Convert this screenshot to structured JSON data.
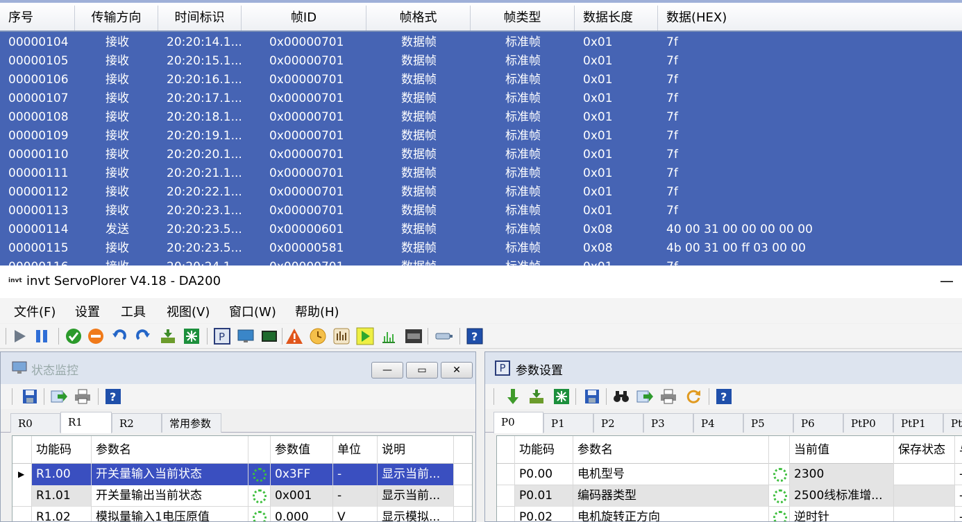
{
  "can_grid": {
    "columns": [
      "序号",
      "传输方向",
      "时间标识",
      "帧ID",
      "帧格式",
      "帧类型",
      "数据长度",
      "数据(HEX)"
    ],
    "rows": [
      [
        "00000104",
        "接收",
        "20:20:14.1...",
        "0x00000701",
        "数据帧",
        "标准帧",
        "0x01",
        "7f"
      ],
      [
        "00000105",
        "接收",
        "20:20:15.1...",
        "0x00000701",
        "数据帧",
        "标准帧",
        "0x01",
        "7f"
      ],
      [
        "00000106",
        "接收",
        "20:20:16.1...",
        "0x00000701",
        "数据帧",
        "标准帧",
        "0x01",
        "7f"
      ],
      [
        "00000107",
        "接收",
        "20:20:17.1...",
        "0x00000701",
        "数据帧",
        "标准帧",
        "0x01",
        "7f"
      ],
      [
        "00000108",
        "接收",
        "20:20:18.1...",
        "0x00000701",
        "数据帧",
        "标准帧",
        "0x01",
        "7f"
      ],
      [
        "00000109",
        "接收",
        "20:20:19.1...",
        "0x00000701",
        "数据帧",
        "标准帧",
        "0x01",
        "7f"
      ],
      [
        "00000110",
        "接收",
        "20:20:20.1...",
        "0x00000701",
        "数据帧",
        "标准帧",
        "0x01",
        "7f"
      ],
      [
        "00000111",
        "接收",
        "20:20:21.1...",
        "0x00000701",
        "数据帧",
        "标准帧",
        "0x01",
        "7f"
      ],
      [
        "00000112",
        "接收",
        "20:20:22.1...",
        "0x00000701",
        "数据帧",
        "标准帧",
        "0x01",
        "7f"
      ],
      [
        "00000113",
        "接收",
        "20:20:23.1...",
        "0x00000701",
        "数据帧",
        "标准帧",
        "0x01",
        "7f"
      ],
      [
        "00000114",
        "发送",
        "20:20:23.5...",
        "0x00000601",
        "数据帧",
        "标准帧",
        "0x08",
        "40 00 31 00 00 00 00 00"
      ],
      [
        "00000115",
        "接收",
        "20:20:23.5...",
        "0x00000581",
        "数据帧",
        "标准帧",
        "0x08",
        "4b 00 31 00 ff 03 00 00"
      ]
    ],
    "partial_row": [
      "00000116",
      "接收",
      "20:20:24.1...",
      "0x00000701",
      "数据帧",
      "标准帧",
      "0x01",
      "7f"
    ],
    "selection_color": "#4664b4"
  },
  "window": {
    "logo": "invt",
    "title": "invt ServoPlorer V4.18 - DA200",
    "minimize_glyph": "—"
  },
  "menu": [
    "文件(F)",
    "设置",
    "工具",
    "视图(V)",
    "窗口(W)",
    "帮助(H)"
  ],
  "toolbar_icons": [
    "play-icon",
    "pause-icon",
    "check-icon",
    "stop-icon",
    "undo-icon",
    "redo-icon",
    "download-icon",
    "grid-icon",
    "param-icon",
    "monitor-icon",
    "terminal-icon",
    "warning-icon",
    "clock-icon",
    "meter-icon",
    "scope-icon",
    "chart-icon",
    "app-icon",
    "plug-icon",
    "help-icon"
  ],
  "status_panel": {
    "title": "状态监控",
    "tabs": [
      "R0",
      "R1",
      "R2",
      "常用参数"
    ],
    "active_tab": "R1",
    "columns": [
      "功能码",
      "参数名",
      "",
      "参数值",
      "单位",
      "说明"
    ],
    "rows": [
      {
        "code": "R1.00",
        "name": "开关量输入当前状态",
        "value": "0x3FF",
        "unit": "-",
        "desc": "显示当前...",
        "selected": true
      },
      {
        "code": "R1.01",
        "name": "开关量输出当前状态",
        "value": "0x001",
        "unit": "-",
        "desc": "显示当前...",
        "selected": false
      },
      {
        "code": "R1.02",
        "name": "模拟量输入1电压原值",
        "value": "0.000",
        "unit": "V",
        "desc": "显示模拟...",
        "selected": false
      }
    ],
    "row_marker": "▶"
  },
  "param_panel": {
    "title": "参数设置",
    "title_icon": "P",
    "tabs": [
      "P0",
      "P1",
      "P2",
      "P3",
      "P4",
      "P5",
      "P6",
      "PtP0",
      "PtP1",
      "Pt"
    ],
    "active_tab": "P0",
    "columns": [
      "功能码",
      "参数名",
      "",
      "当前值",
      "保存状态",
      "与"
    ],
    "rows": [
      {
        "code": "P0.00",
        "name": "电机型号",
        "value": "2300"
      },
      {
        "code": "P0.01",
        "name": "编码器类型",
        "value": "2500线标准增..."
      },
      {
        "code": "P0.02",
        "name": "电机旋转正方向",
        "value": "逆时针"
      }
    ]
  }
}
